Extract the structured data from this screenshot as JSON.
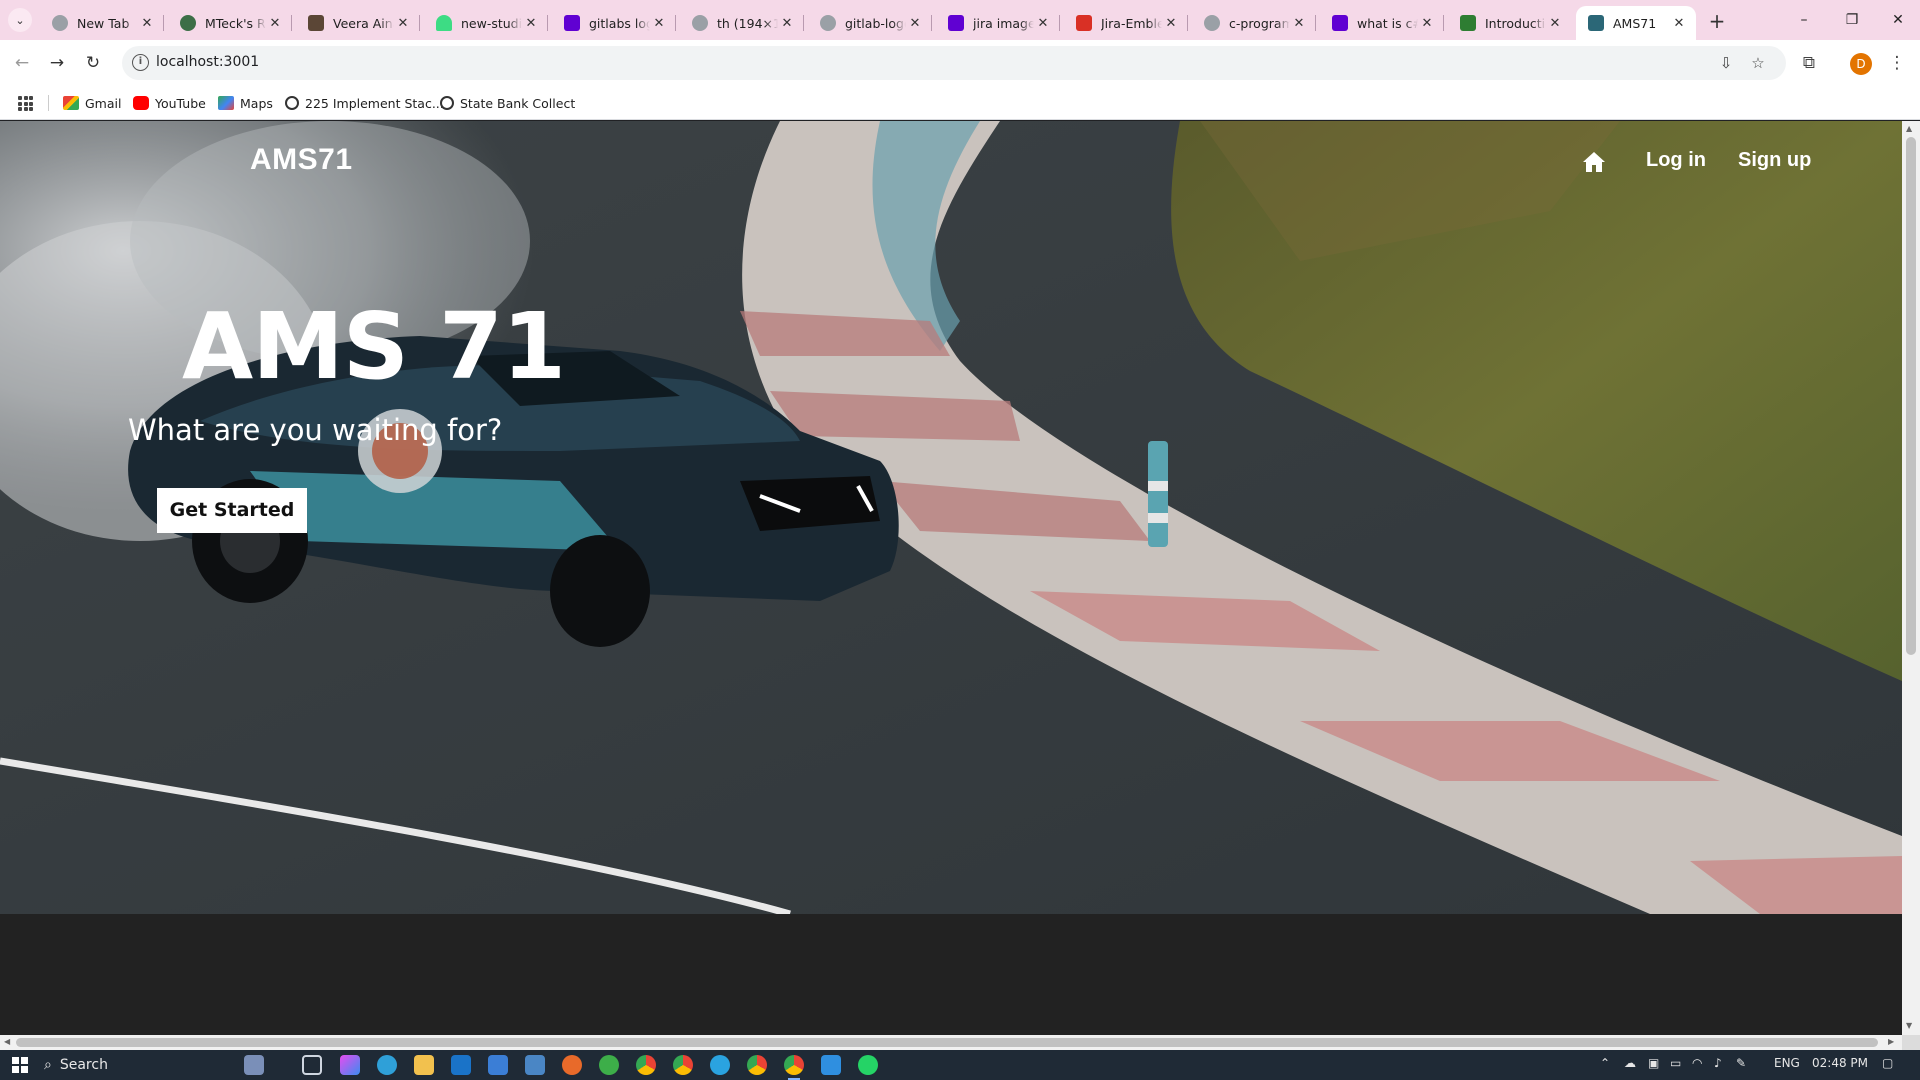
{
  "browser": {
    "tabs": [
      {
        "title": "New Tab",
        "favicon_color": "#9aa0a6",
        "active": false
      },
      {
        "title": "MTeck's Re",
        "favicon_color": "#3c6e47",
        "active": false
      },
      {
        "title": "Veera Aina",
        "favicon_color": "#5b4636",
        "active": false
      },
      {
        "title": "new-studi",
        "favicon_color": "#3ddc84",
        "active": false
      },
      {
        "title": "gitlabs log",
        "favicon_color": "#6001d2",
        "active": false
      },
      {
        "title": "th (194×18",
        "favicon_color": "#9aa0a6",
        "active": false
      },
      {
        "title": "gitlab-logo",
        "favicon_color": "#9aa0a6",
        "active": false
      },
      {
        "title": "jira image",
        "favicon_color": "#6001d2",
        "active": false
      },
      {
        "title": "Jira-Emble",
        "favicon_color": "#d93025",
        "active": false
      },
      {
        "title": "c-program",
        "favicon_color": "#9aa0a6",
        "active": false
      },
      {
        "title": "what is c#",
        "favicon_color": "#6001d2",
        "active": false
      },
      {
        "title": "Introductio",
        "favicon_color": "#2e7d32",
        "active": false
      },
      {
        "title": "AMS71",
        "favicon_color": "#2b6777",
        "active": true
      }
    ],
    "new_tab_symbol": "+",
    "window_controls": {
      "minimize": "–",
      "restore": "❐",
      "close": "✕"
    },
    "address_bar": {
      "url": "localhost:3001"
    },
    "profile_initial": "D",
    "bookmarks": [
      {
        "label": "Gmail",
        "icon": "gmail-icon",
        "color": "#ea4335"
      },
      {
        "label": "YouTube",
        "icon": "youtube-icon",
        "color": "#ff0000"
      },
      {
        "label": "Maps",
        "icon": "maps-icon",
        "color": "#34a853"
      },
      {
        "label": "225 Implement Stac...",
        "icon": "globe-icon",
        "color": "#333333"
      },
      {
        "label": "State Bank Collect",
        "icon": "globe-icon",
        "color": "#333333"
      }
    ]
  },
  "site": {
    "brand": "AMS71",
    "nav": {
      "home_icon": "home-icon",
      "login": "Log in",
      "signup": "Sign up"
    },
    "hero": {
      "title": "AMS 71",
      "subtitle": "What are you waiting for?",
      "cta": "Get Started"
    },
    "colors": {
      "footer_band": "#222222",
      "text": "#ffffff",
      "cta_bg": "#ffffff"
    }
  },
  "taskbar": {
    "search_label": "Search",
    "language": "ENG",
    "time": "02:48 PM"
  }
}
